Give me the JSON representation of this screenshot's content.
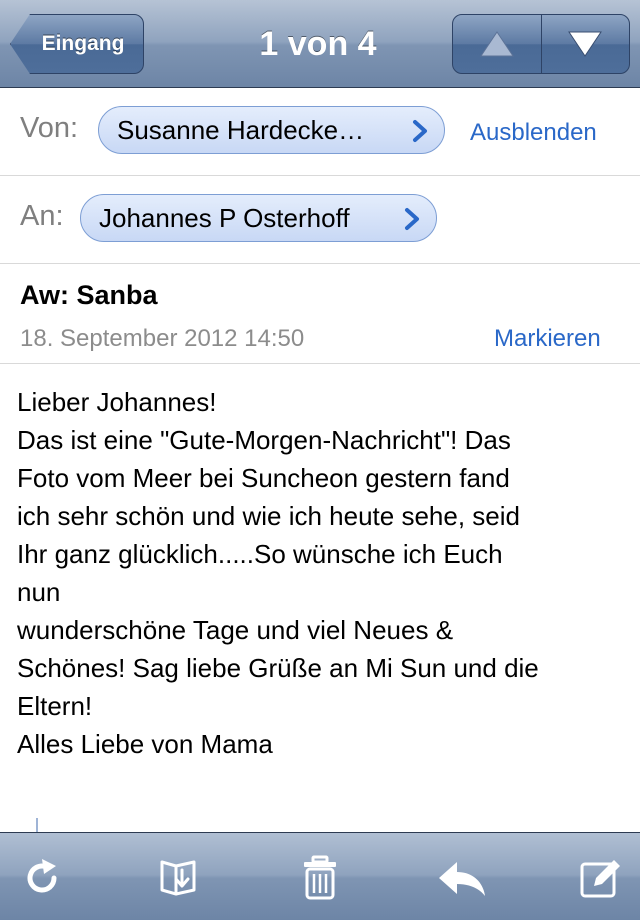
{
  "navbar": {
    "back_label": "Eingang",
    "title": "1 von 4",
    "prev_icon": "triangle-up-icon",
    "next_icon": "triangle-down-icon"
  },
  "header": {
    "from_label": "Von:",
    "from_name": "Susanne Hardecke…",
    "hide_link": "Ausblenden",
    "to_label": "An:",
    "to_name": "Johannes P Osterhoff",
    "subject": "Aw: Sanba",
    "date": "18. September 2012 14:50",
    "mark_link": "Markieren"
  },
  "message": {
    "lines": [
      "Lieber Johannes!",
      "Das ist eine \"Gute-Morgen-Nachricht\"! Das",
      "Foto vom Meer bei Suncheon gestern fand",
      "ich sehr schön und wie ich heute sehe, seid",
      "Ihr ganz glücklich.....So wünsche ich Euch",
      "nun",
      "wunderschöne Tage und viel Neues &",
      "Schönes! Sag liebe Grüße an Mi Sun und die",
      "Eltern!",
      "Alles Liebe von Mama"
    ]
  },
  "toolbar": {
    "icons": [
      "refresh-icon",
      "move-to-folder-icon",
      "trash-icon",
      "reply-icon",
      "compose-icon"
    ]
  },
  "colors": {
    "accent_link": "#2a68c8",
    "nav_bar": "#7f95b3",
    "pill_fill": "#c8d8f5"
  }
}
